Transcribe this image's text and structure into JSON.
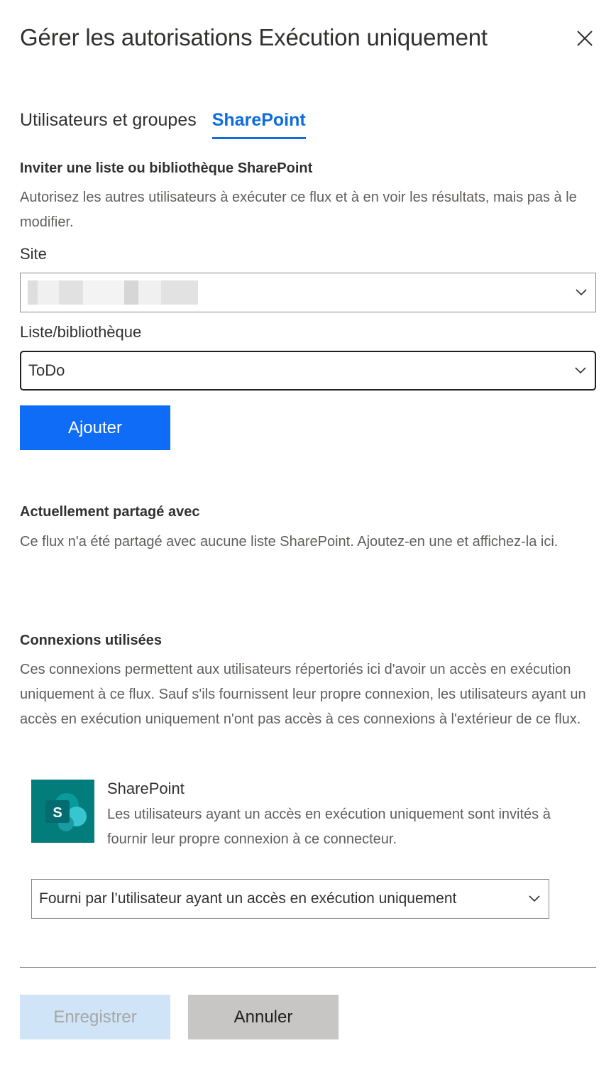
{
  "panel": {
    "title": "Gérer les autorisations Exécution uniquement",
    "close_icon": "close-icon"
  },
  "tabs": [
    {
      "label": "Utilisateurs et groupes",
      "active": false
    },
    {
      "label": "SharePoint",
      "active": true
    }
  ],
  "invite": {
    "heading": "Inviter une liste ou bibliothèque SharePoint",
    "description": "Autorisez les autres utilisateurs à exécuter ce flux et à en voir les résultats, mais pas à le modifier.",
    "site_label": "Site",
    "site_value": "",
    "list_label": "Liste/bibliothèque",
    "list_value": "ToDo",
    "add_button": "Ajouter"
  },
  "shared": {
    "heading": "Actuellement partagé avec",
    "description": "Ce flux n'a été partagé avec aucune liste SharePoint. Ajoutez-en une et affichez-la ici."
  },
  "connections": {
    "heading": "Connexions utilisées",
    "description": "Ces connexions permettent aux utilisateurs répertoriés ici d'avoir un accès en exécution uniquement à ce flux. Sauf s'ils fournissent leur propre connexion, les utilisateurs ayant un accès en exécution uniquement n'ont pas accès à ces connexions à l'extérieur de ce flux.",
    "items": [
      {
        "icon": "sharepoint-icon",
        "icon_letter": "S",
        "name": "SharePoint",
        "description": "Les utilisateurs ayant un accès en exécution uniquement sont invités à fournir leur propre connexion à ce connecteur.",
        "selected_option": "Fourni par l’utilisateur ayant un accès en exécution uniquement"
      }
    ]
  },
  "footer": {
    "save_button": "Enregistrer",
    "cancel_button": "Annuler"
  },
  "colors": {
    "accent": "#0f6cde",
    "primary_button": "#0f6cf6",
    "disabled_button": "#cfe4f7",
    "secondary_button": "#c8c6c4",
    "sharepoint_teal": "#037c7c"
  }
}
